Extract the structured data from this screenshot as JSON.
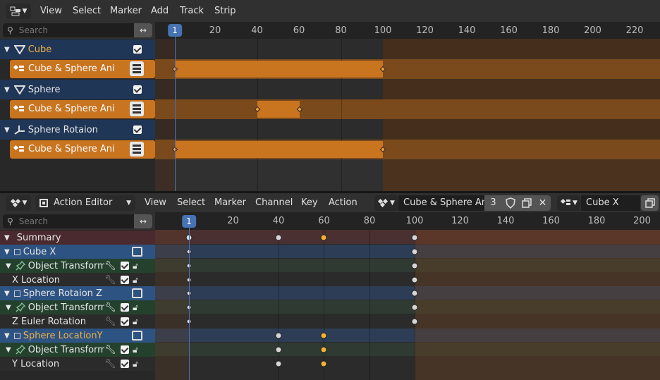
{
  "nla": {
    "menu": [
      "View",
      "Select",
      "Marker",
      "Add",
      "Track",
      "Strip"
    ],
    "search_placeholder": "Search",
    "current_frame": "1",
    "ruler_ticks": [
      "20",
      "40",
      "60",
      "80",
      "100",
      "120",
      "140",
      "160",
      "180",
      "200",
      "220"
    ],
    "tracks": [
      {
        "name": "Cube",
        "strip": "Cube & Sphere Ani"
      },
      {
        "name": "Sphere",
        "strip": "Cube & Sphere Ani"
      },
      {
        "name": "Sphere Rotaion",
        "strip": "Cube & Sphere Ani"
      }
    ]
  },
  "action_editor": {
    "mode": "Action Editor",
    "menu": [
      "View",
      "Select",
      "Marker",
      "Channel",
      "Key",
      "Action"
    ],
    "action_name": "Cube & Sphere Ani",
    "users": "3",
    "slot_name": "Cube X",
    "search_placeholder": "Search",
    "current_frame": "1",
    "ruler_ticks": [
      "20",
      "40",
      "60",
      "80",
      "100",
      "120",
      "140",
      "160",
      "180",
      "200"
    ],
    "channels": [
      {
        "label": "Summary"
      },
      {
        "label": "Cube X"
      },
      {
        "label": "Object Transforms"
      },
      {
        "label": "X Location"
      },
      {
        "label": "Sphere Rotaion Z"
      },
      {
        "label": "Object Transforms"
      },
      {
        "label": "Z Euler Rotation"
      },
      {
        "label": "Sphere LocationY"
      },
      {
        "label": "Object Transforms"
      },
      {
        "label": "Y Location"
      }
    ]
  },
  "colors": {
    "selected_blue": "#4772b3",
    "nla_strip": "#c9741f",
    "keyframe_selected": "#f2b233",
    "keyframe_unselected": "#d6d6d6"
  }
}
